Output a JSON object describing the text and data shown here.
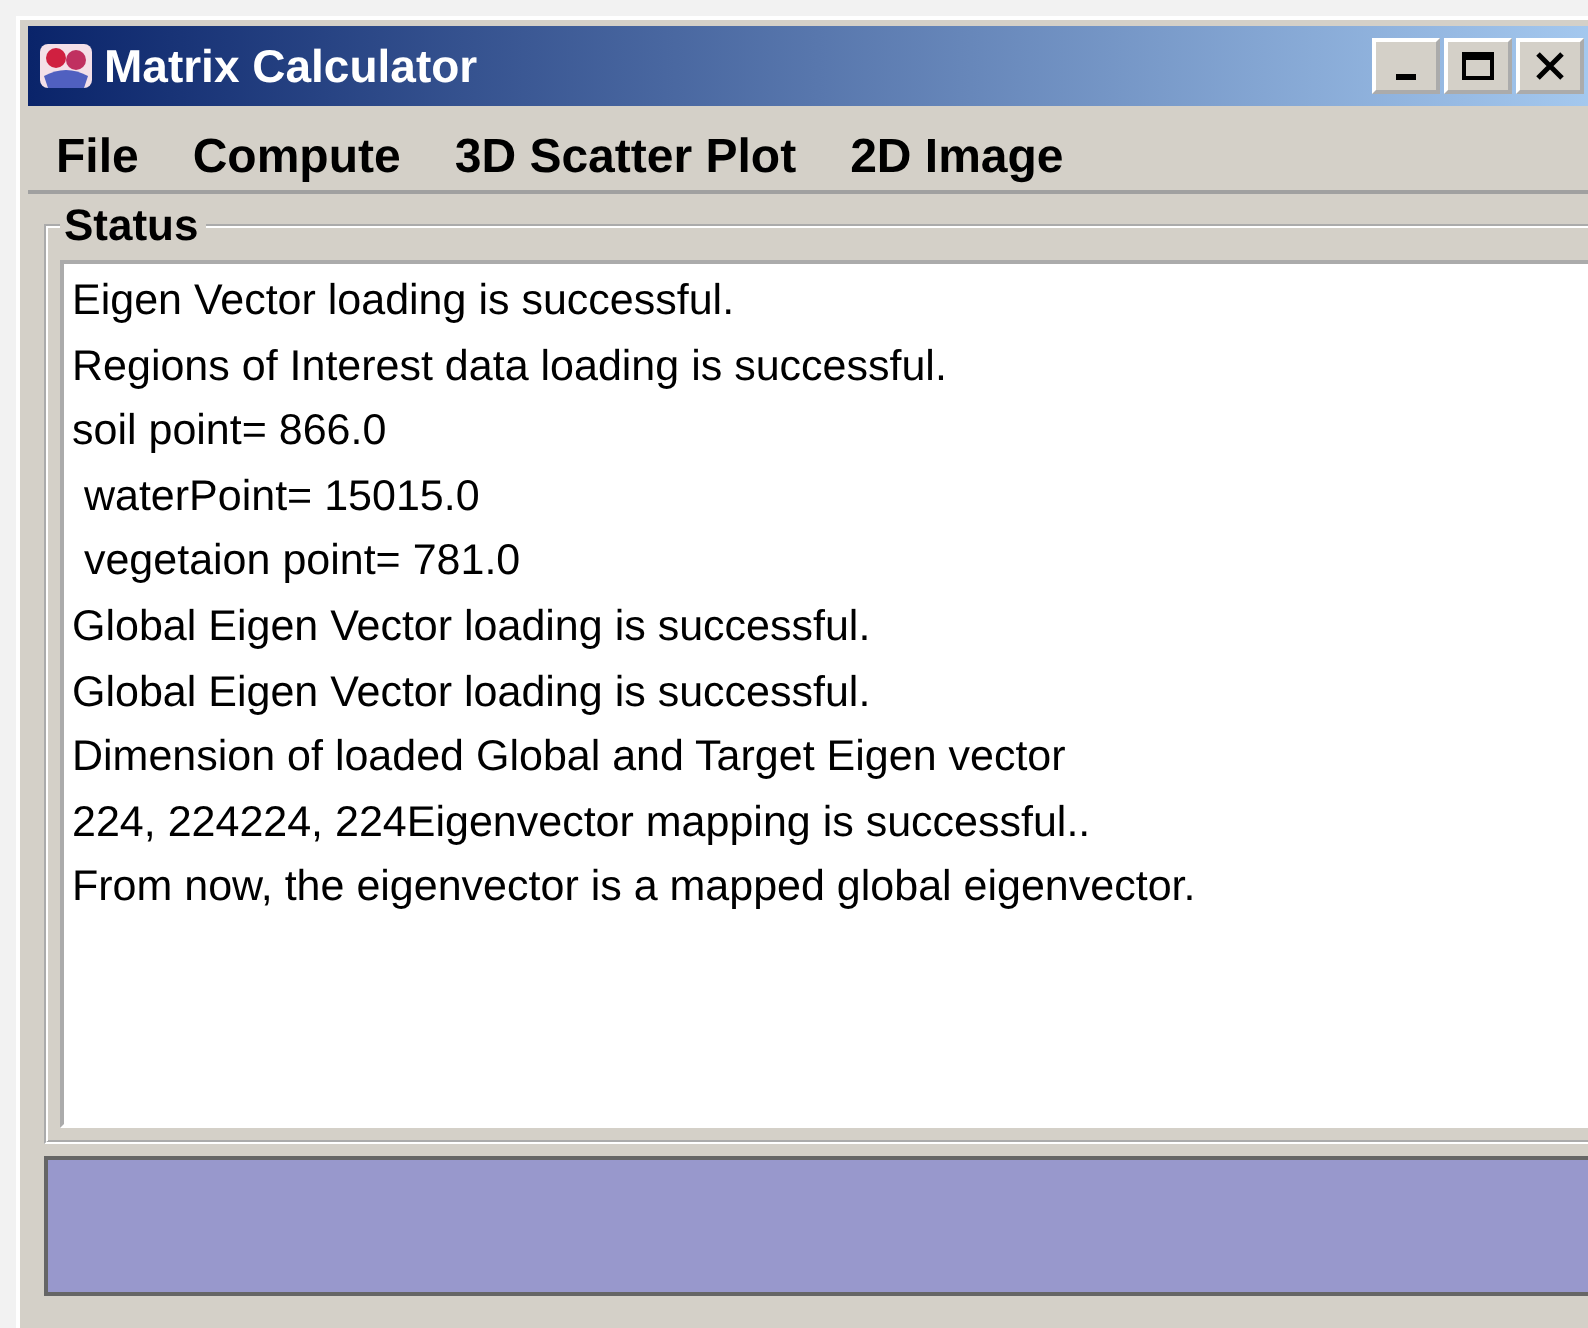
{
  "window": {
    "title": "Matrix Calculator"
  },
  "menu": [
    "File",
    "Compute",
    "3D Scatter Plot",
    "2D Image"
  ],
  "status": {
    "title": "Status",
    "lines": [
      "Eigen Vector loading is successful.",
      "Regions of Interest data loading is successful.",
      "soil point= 866.0",
      " waterPoint= 15015.0",
      " vegetaion point= 781.0",
      "Global Eigen Vector loading is successful.",
      "Global Eigen Vector loading is successful.",
      "Dimension of loaded Global and Target Eigen vector",
      "224, 224224, 224Eigenvector mapping is successful..",
      "From now, the eigenvector is a mapped global eigenvector."
    ]
  }
}
